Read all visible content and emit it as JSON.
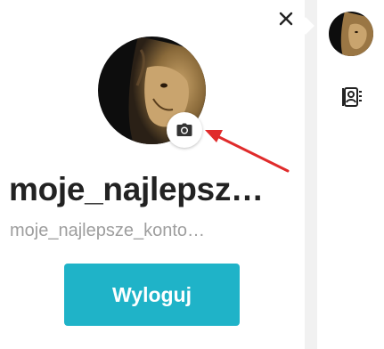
{
  "profile": {
    "display_name": "moje_najlepsze_konto",
    "display_name_shown": "moje_najlepsz…",
    "username": "moje_najlepsze_konto",
    "username_shown": "moje_najlepsze_konto…",
    "avatar": "lion-portrait"
  },
  "actions": {
    "logout_label": "Wyloguj",
    "close_icon": "close-icon",
    "change_photo_icon": "camera-icon"
  },
  "rail": {
    "avatar": "lion-portrait",
    "contact_icon": "contact-card-icon"
  },
  "annotation": {
    "arrow_color": "#e02b2b"
  },
  "colors": {
    "accent": "#1fb3c8",
    "name_text": "#222222",
    "username_text": "#9e9e9e",
    "divider": "#f1f1f1"
  }
}
